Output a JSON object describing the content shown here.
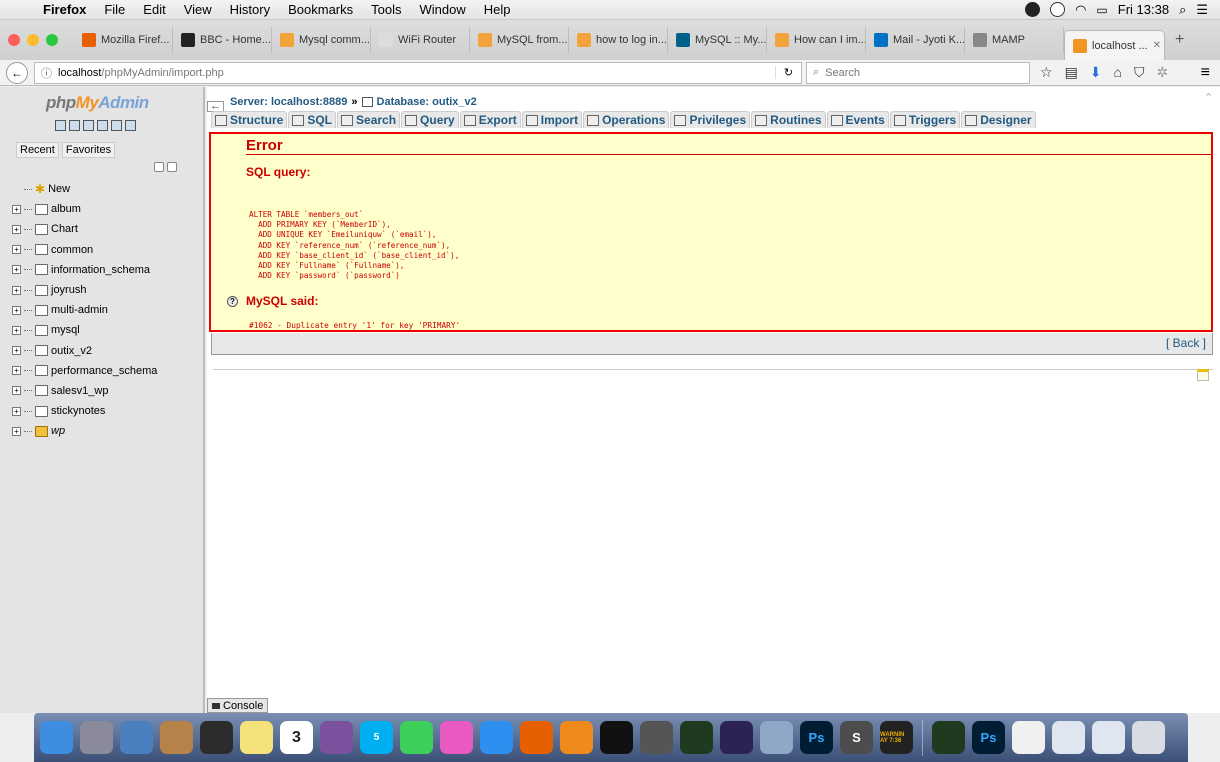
{
  "menubar": {
    "apple": "",
    "items": [
      "Firefox",
      "File",
      "Edit",
      "View",
      "History",
      "Bookmarks",
      "Tools",
      "Window",
      "Help"
    ],
    "clock": "Fri 13:38"
  },
  "tabs": [
    {
      "label": "Mozilla Firef...",
      "color": "#e66000"
    },
    {
      "label": "BBC - Home...",
      "color": "#222222"
    },
    {
      "label": "Mysql comm...",
      "color": "#f2a33a"
    },
    {
      "label": "WiFi Router",
      "color": "#dddddd"
    },
    {
      "label": "MySQL from...",
      "color": "#f2a33a"
    },
    {
      "label": "how to log in...",
      "color": "#f2a33a"
    },
    {
      "label": "MySQL :: My...",
      "color": "#00618a"
    },
    {
      "label": "How can I im...",
      "color": "#f2a33a"
    },
    {
      "label": "Mail - Jyoti K...",
      "color": "#0072c6"
    },
    {
      "label": "MAMP",
      "color": "#888888"
    },
    {
      "label": "localhost ...",
      "color": "#f29423"
    }
  ],
  "urlbar": {
    "info_icon": "ⓘ",
    "url_host": "localhost",
    "url_path": "/phpMyAdmin/import.php",
    "search_placeholder": "Search"
  },
  "sidebar": {
    "logo_php": "php",
    "logo_my": "My",
    "logo_admin": "Admin",
    "tab_recent": "Recent",
    "tab_favorites": "Favorites",
    "new_label": "New",
    "databases": [
      "album",
      "Chart",
      "common",
      "information_schema",
      "joyrush",
      "multi-admin",
      "mysql",
      "outix_v2",
      "performance_schema",
      "salesv1_wp",
      "stickynotes",
      "wp"
    ]
  },
  "breadcrumb": {
    "server": "Server: localhost:8889",
    "separator": "»",
    "database": "Database: outix_v2"
  },
  "topmenu": [
    "Structure",
    "SQL",
    "Search",
    "Query",
    "Export",
    "Import",
    "Operations",
    "Privileges",
    "Routines",
    "Events",
    "Triggers",
    "Designer"
  ],
  "error": {
    "title": "Error",
    "sql_query_label": "SQL query:",
    "sql_lines": [
      "ALTER TABLE `members_out`",
      "  ADD PRIMARY KEY (`MemberID`),",
      "  ADD UNIQUE KEY `Emeiluniquw` (`email`),",
      "  ADD KEY `reference_num` (`reference_num`),",
      "  ADD KEY `base_client_id` (`base_client_id`),",
      "  ADD KEY `Fullname` (`Fullname`),",
      "  ADD KEY `password` (`password`)"
    ],
    "mysql_said_label": "MySQL said:",
    "error_message": "#1062 - Duplicate entry '1' for key 'PRIMARY'"
  },
  "back_link": "[ Back ]",
  "console_label": "Console",
  "dock": [
    {
      "name": "finder",
      "color": "#3f8de0"
    },
    {
      "name": "launchpad",
      "color": "#8a8a9a"
    },
    {
      "name": "preview",
      "color": "#4a7fc0"
    },
    {
      "name": "contacts",
      "color": "#b5824a"
    },
    {
      "name": "photo-booth",
      "color": "#2c2c2c"
    },
    {
      "name": "notes",
      "color": "#f5e27a"
    },
    {
      "name": "calendar",
      "color": "#ffffff"
    },
    {
      "name": "viber",
      "color": "#7b519d"
    },
    {
      "name": "skype",
      "color": "#00aff0"
    },
    {
      "name": "facetime",
      "color": "#3ecf5a"
    },
    {
      "name": "itunes",
      "color": "#e85ac2"
    },
    {
      "name": "app-store",
      "color": "#2d8ff0"
    },
    {
      "name": "firefox",
      "color": "#e66000"
    },
    {
      "name": "ibooks",
      "color": "#f08a1c"
    },
    {
      "name": "terminal",
      "color": "#111111"
    },
    {
      "name": "sequel-pro",
      "color": "#555555"
    },
    {
      "name": "activity-monitor",
      "color": "#1f3a1f"
    },
    {
      "name": "eclipse",
      "color": "#2c2255"
    },
    {
      "name": "image-capture",
      "color": "#8fa8c8"
    },
    {
      "name": "photoshop",
      "color": "#001d34"
    },
    {
      "name": "sublime-text",
      "color": "#4d4d4d"
    },
    {
      "name": "console",
      "color": "#222222"
    },
    {
      "name": "activity-monitor-2",
      "color": "#1f3a1f"
    },
    {
      "name": "photoshop-2",
      "color": "#001d34"
    },
    {
      "name": "document",
      "color": "#f0f0f0"
    },
    {
      "name": "documents-folder",
      "color": "#dfe6ef"
    },
    {
      "name": "downloads-folder",
      "color": "#dfe6ef"
    },
    {
      "name": "trash",
      "color": "#d9dde3"
    }
  ],
  "dock_labels": {
    "calendar_month": "MAR",
    "calendar_day": "3",
    "skype_badge": "5",
    "photoshop": "Ps",
    "sublime": "S",
    "console_text": "WARNIN AY 7:36"
  },
  "colors": {
    "error_red": "#cc0000",
    "error_bg": "#ffffcc",
    "link_blue": "#235a81"
  }
}
